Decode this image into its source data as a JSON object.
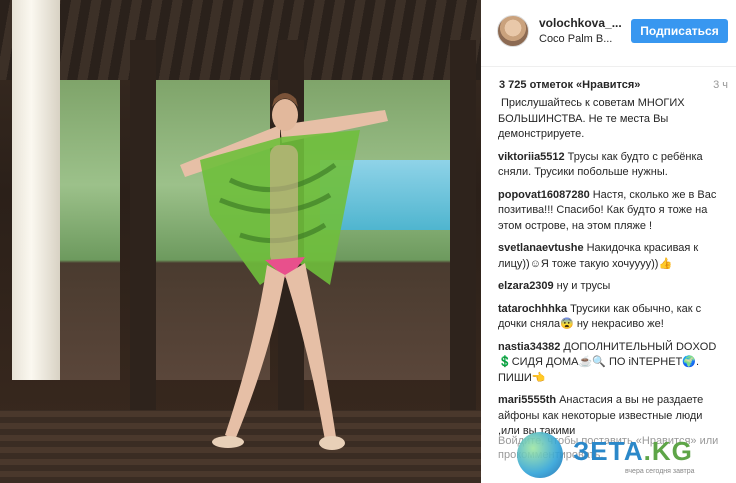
{
  "header": {
    "username": "volochkova_...",
    "location": "Coco Palm B...",
    "follow_label": "Подписаться"
  },
  "post": {
    "likes": "3 725 отметок «Нравится»",
    "time": "3 ч"
  },
  "comments": [
    {
      "author": "",
      "text": "Прислушайтесь к советам МНОГИХ БОЛЬШИНСТВА. Не те места Вы демонстрируете."
    },
    {
      "author": "viktoriia5512",
      "text": "Трусы как будто с ребёнка сняли. Трусики побольше нужны."
    },
    {
      "author": "popovat16087280",
      "text": "Настя, сколько же в Вас позитива!!! Спасибо! Как будто я тоже на этом острове, на этом пляже !"
    },
    {
      "author": "svetlanaevtushe",
      "text": "Накидочка красивая к лицу))☺Я тоже такую хочуууу))👍"
    },
    {
      "author": "elzara2309",
      "text": "ну и трусы"
    },
    {
      "author": "tatarochhhka",
      "text": "Трусики как обычно, как с дочки сняла😨 ну некрасиво же!"
    },
    {
      "author": "nastia34382",
      "text": "ДОПОЛНИТЕЛЬНЫЙ DOXOD 💲СИДЯ ДОМА☕🔍 ПО iNTEPHET🌍. ПИШИ👈"
    },
    {
      "author": "mari5555th",
      "text": "Анастасия а вы не раздаете айфоны как некоторые известные люди ,или вы такими"
    }
  ],
  "footer": {
    "login_link": "Войдите",
    "text": ", чтобы поставить «Нравится» или прокомментировать."
  },
  "watermark": {
    "brand": "ЗЕТА",
    "tld": ".KG",
    "slogan": "вчера сегодня завтра"
  },
  "colors": {
    "follow_button": "#3897f0",
    "link_grey": "#999999",
    "cape": "#6fbf3c"
  }
}
